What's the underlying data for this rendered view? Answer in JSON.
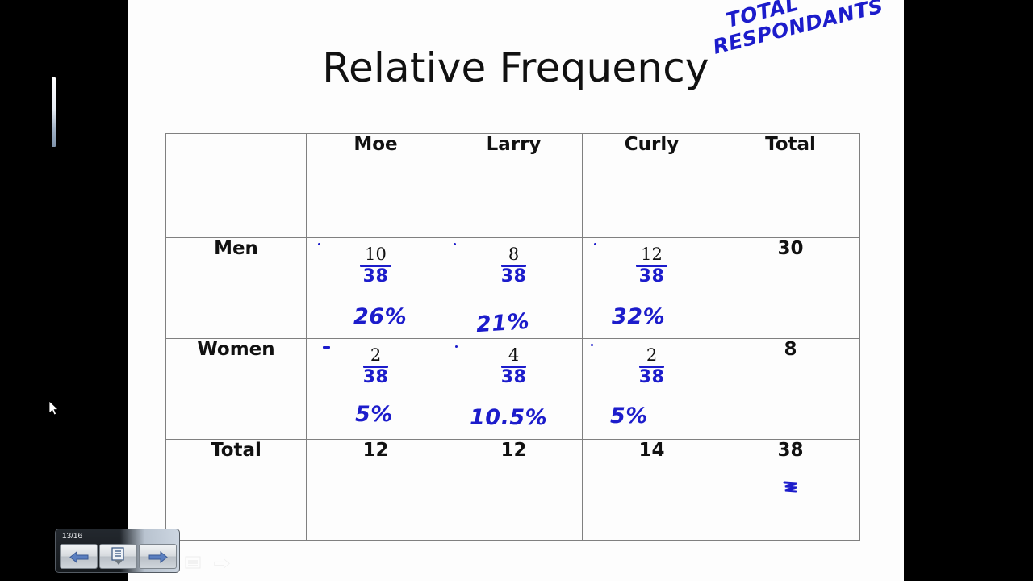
{
  "slide": {
    "title": "Relative Frequency",
    "annotation": {
      "line1": "TOTAL",
      "line2": "RESPONDANTS",
      "ink_color": "#1c1ccb"
    }
  },
  "table": {
    "corner_label": "",
    "column_headers": [
      "Moe",
      "Larry",
      "Curly",
      "Total"
    ],
    "rows": [
      {
        "label": "Men",
        "cells": [
          {
            "numerator": "10",
            "denominator": "38",
            "percent": "26%"
          },
          {
            "numerator": "8",
            "denominator": "38",
            "percent": "21%"
          },
          {
            "numerator": "12",
            "denominator": "38",
            "percent": "32%"
          }
        ],
        "total": "30"
      },
      {
        "label": "Women",
        "cells": [
          {
            "numerator": "2",
            "denominator": "38",
            "percent": "5%"
          },
          {
            "numerator": "4",
            "denominator": "38",
            "percent": "10.5%"
          },
          {
            "numerator": "2",
            "denominator": "38",
            "percent": "5%"
          }
        ],
        "total": "8"
      }
    ],
    "total_row": {
      "label": "Total",
      "values": [
        "12",
        "12",
        "14"
      ],
      "grand_total": "38"
    }
  },
  "player": {
    "slide_counter": "13/16",
    "buttons": [
      {
        "name": "previous-slide",
        "icon": "left-arrow-icon"
      },
      {
        "name": "slide-menu",
        "icon": "document-dropdown-icon"
      },
      {
        "name": "next-slide",
        "icon": "right-arrow-icon"
      }
    ]
  },
  "colors": {
    "ink": "#1c1ccb",
    "text": "#111111",
    "table_border": "#808080",
    "slide_background": "#fdfdfd",
    "letterbox": "#000000"
  }
}
